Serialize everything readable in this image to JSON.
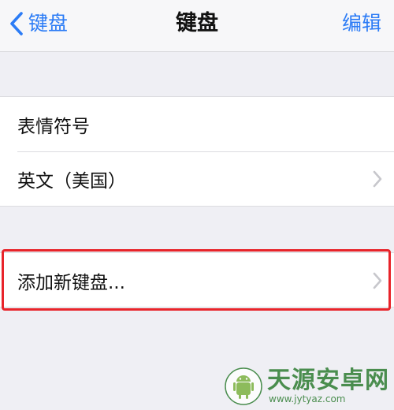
{
  "navbar": {
    "back_label": "键盘",
    "title": "键盘",
    "edit_label": "编辑"
  },
  "keyboards": [
    {
      "label": "表情符号",
      "has_chevron": false
    },
    {
      "label": "英文（美国）",
      "has_chevron": true
    }
  ],
  "add_keyboard": {
    "label": "添加新键盘..."
  },
  "watermark": {
    "title": "天源安卓网",
    "url": "www.jytyaz.com"
  },
  "colors": {
    "accent": "#2c7cf6",
    "highlight": "#e8242a",
    "background": "#efeff4"
  },
  "icons": {
    "back": "chevron-left-icon",
    "disclosure": "chevron-right-icon",
    "watermark_logo": "android-robot-icon"
  }
}
